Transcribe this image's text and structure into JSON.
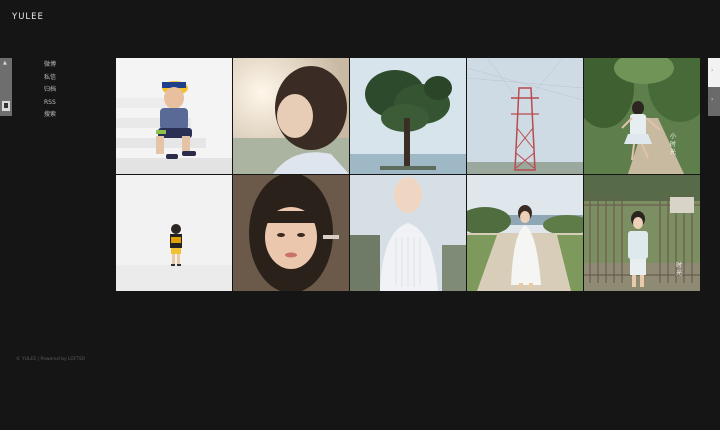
{
  "site": {
    "title": "YULEE",
    "footer": "© YULEE | Powered by LOFTER"
  },
  "nav": {
    "items": [
      "微博",
      "私信",
      "归档",
      "RSS",
      "搜索"
    ]
  },
  "left_tab": {
    "arrow_icon": "up-arrow-icon",
    "avatar_icon": "avatar-icon"
  },
  "right_tabs": {
    "upper_icon": "chevron-right-icon",
    "lower_icon": "chevron-right-icon"
  },
  "photos": [
    {
      "name": "photo-boy-cap-on-white-stairs"
    },
    {
      "name": "photo-girl-bob-haircut-profile"
    },
    {
      "name": "photo-pine-tree-against-sky"
    },
    {
      "name": "photo-power-pylon-in-field"
    },
    {
      "name": "photo-girl-running-on-forest-path"
    },
    {
      "name": "photo-toddler-standing-in-white-room"
    },
    {
      "name": "photo-girl-portrait-with-bangs"
    },
    {
      "name": "photo-girl-white-dress-face-hidden"
    },
    {
      "name": "photo-girl-white-dress-by-water"
    },
    {
      "name": "photo-girl-at-rusty-gate"
    }
  ],
  "colors": {
    "background": "#151515",
    "title": "#e8e8e8",
    "nav_text": "#bdbdbd",
    "footer_text": "#5e5e5e"
  }
}
